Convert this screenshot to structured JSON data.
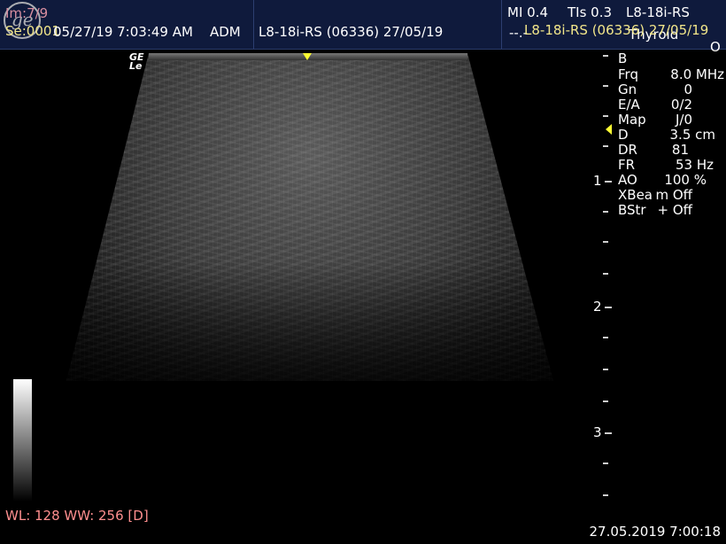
{
  "header": {
    "image_counter": "Im:7/9",
    "series": "Se:0001",
    "date_time": "05/27/19 7:03:49 AM",
    "operator": "ADM",
    "probe_info": "L8-18i-RS (06336) 27/05/19",
    "mi": "MI 0.4",
    "tis": "TIs 0.3",
    "probe_short": "L8-18i-RS",
    "dashes": "--.-",
    "overlap_probe": "L8-18i-RS (06336) 27/05/19",
    "preset": "Thyroid",
    "preset_extra": "O"
  },
  "image": {
    "orientation_mark_line1": "GE",
    "orientation_mark_line2": "Le"
  },
  "parameters": {
    "mode": "B",
    "rows": [
      {
        "label": "Frq",
        "value": "8.0 MHz"
      },
      {
        "label": "Gn",
        "value": "0"
      },
      {
        "label": "E/A",
        "value": "0/2"
      },
      {
        "label": "Map",
        "value": "J/0"
      },
      {
        "label": "D",
        "value": "3.5 cm"
      },
      {
        "label": "DR",
        "value": "81"
      },
      {
        "label": "FR",
        "value": "53 Hz"
      },
      {
        "label": "AO",
        "value": "100 %"
      },
      {
        "label": "XBea",
        "value": "m Off"
      },
      {
        "label": "BStr",
        "value": "+ Off"
      }
    ]
  },
  "depth_scale": {
    "labels": [
      "1",
      "2",
      "3"
    ]
  },
  "footer": {
    "window_level": "WL: 128 WW: 256 [D]",
    "timestamp": "27.05.2019 7:00:18"
  },
  "colors": {
    "header_bg": "#0f1a3c",
    "pink_text": "#d88ea0",
    "yellow_text": "#f2e68a",
    "footer_red": "#ff8f8f",
    "marker_yellow": "#ffff33"
  }
}
